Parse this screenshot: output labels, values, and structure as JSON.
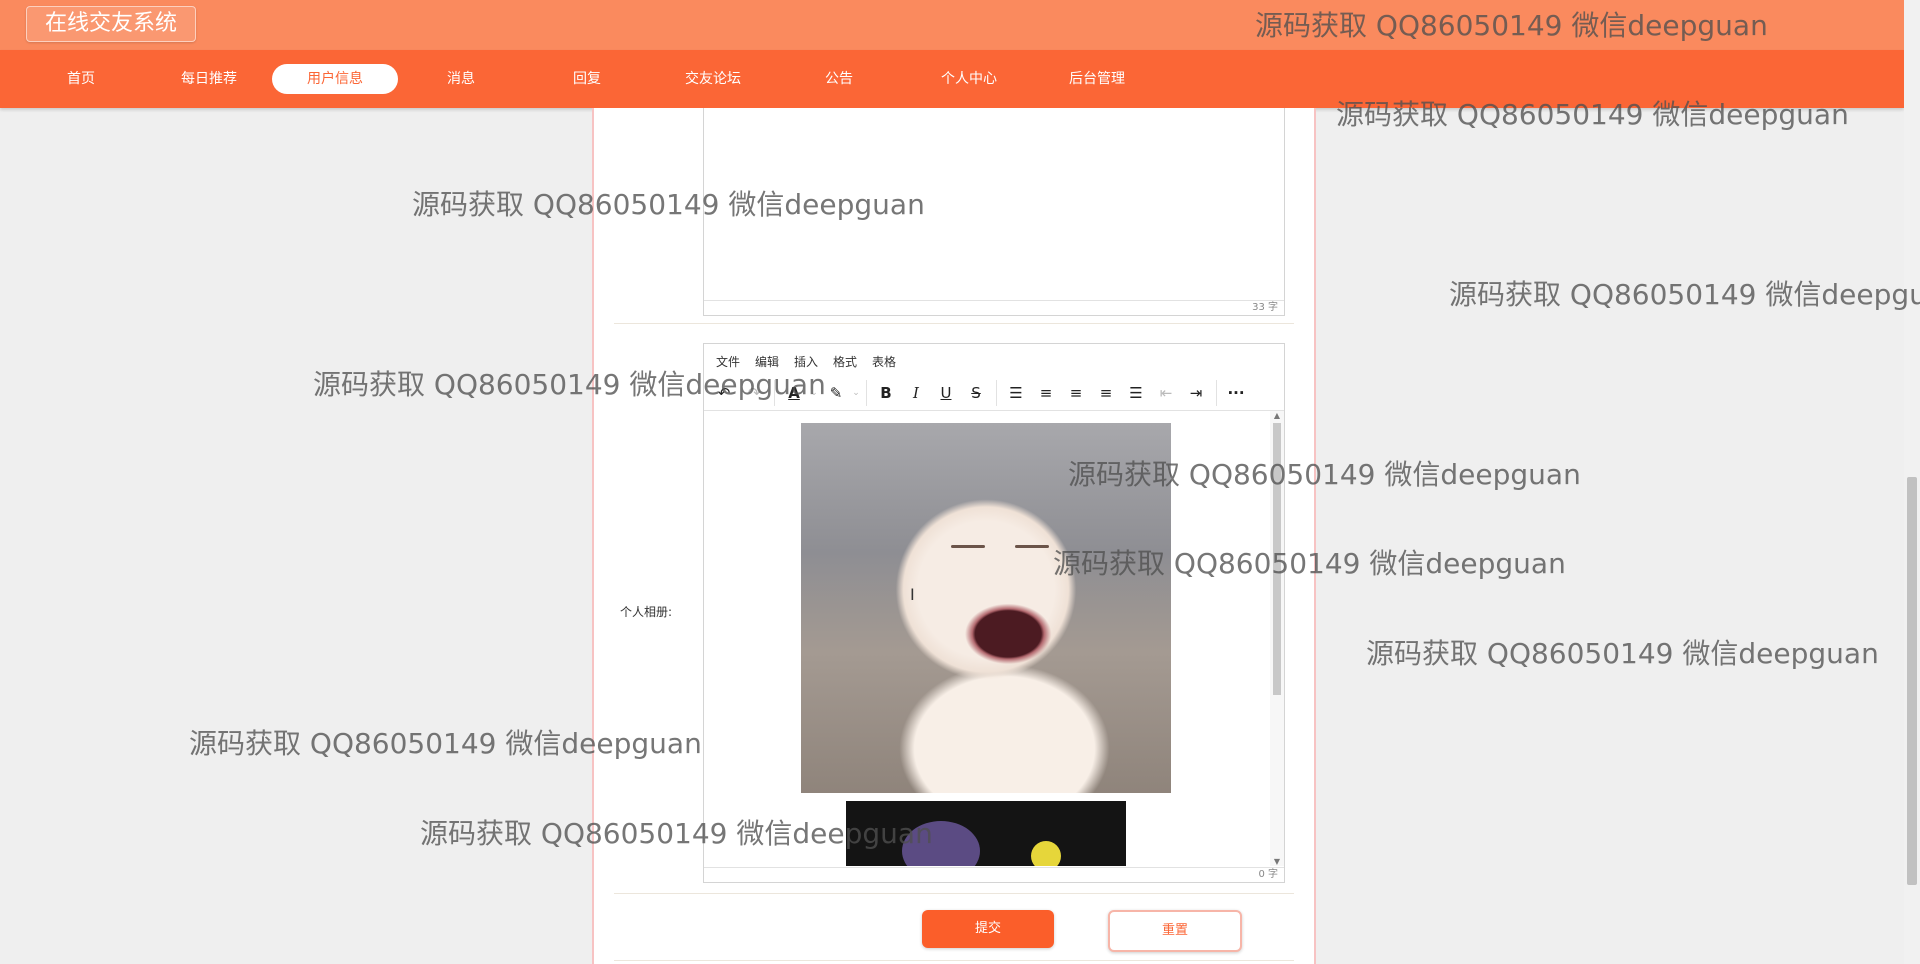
{
  "header": {
    "site_title": "在线交友系统"
  },
  "nav": [
    {
      "label": "首页",
      "active": false
    },
    {
      "label": "每日推荐",
      "active": false
    },
    {
      "label": "用户信息",
      "active": true
    },
    {
      "label": "消息",
      "active": false
    },
    {
      "label": "回复",
      "active": false
    },
    {
      "label": "交友论坛",
      "active": false
    },
    {
      "label": "公告",
      "active": false
    },
    {
      "label": "个人中心",
      "active": false
    },
    {
      "label": "后台管理",
      "active": false
    }
  ],
  "form": {
    "prev_editor": {
      "word_count": "33 字"
    },
    "album": {
      "label": "个人相册:",
      "menus": [
        "文件",
        "编辑",
        "插入",
        "格式",
        "表格"
      ],
      "toolbar_icons": [
        "undo-icon",
        "redo-icon",
        "font-color-icon",
        "highlight-icon",
        "bold-icon",
        "italic-icon",
        "underline-icon",
        "strikethrough-icon",
        "list-icon",
        "align-left-icon",
        "align-center-icon",
        "align-right-icon",
        "justify-icon",
        "outdent-icon",
        "indent-icon",
        "more-icon"
      ],
      "word_count": "0 字"
    },
    "submit_label": "提交",
    "reset_label": "重置"
  },
  "watermark_text": "源码获取 QQ86050149 微信deepguan",
  "colors": {
    "header": "#fa8a5e",
    "nav": "#fb6636",
    "accent": "#fb5e2a"
  }
}
